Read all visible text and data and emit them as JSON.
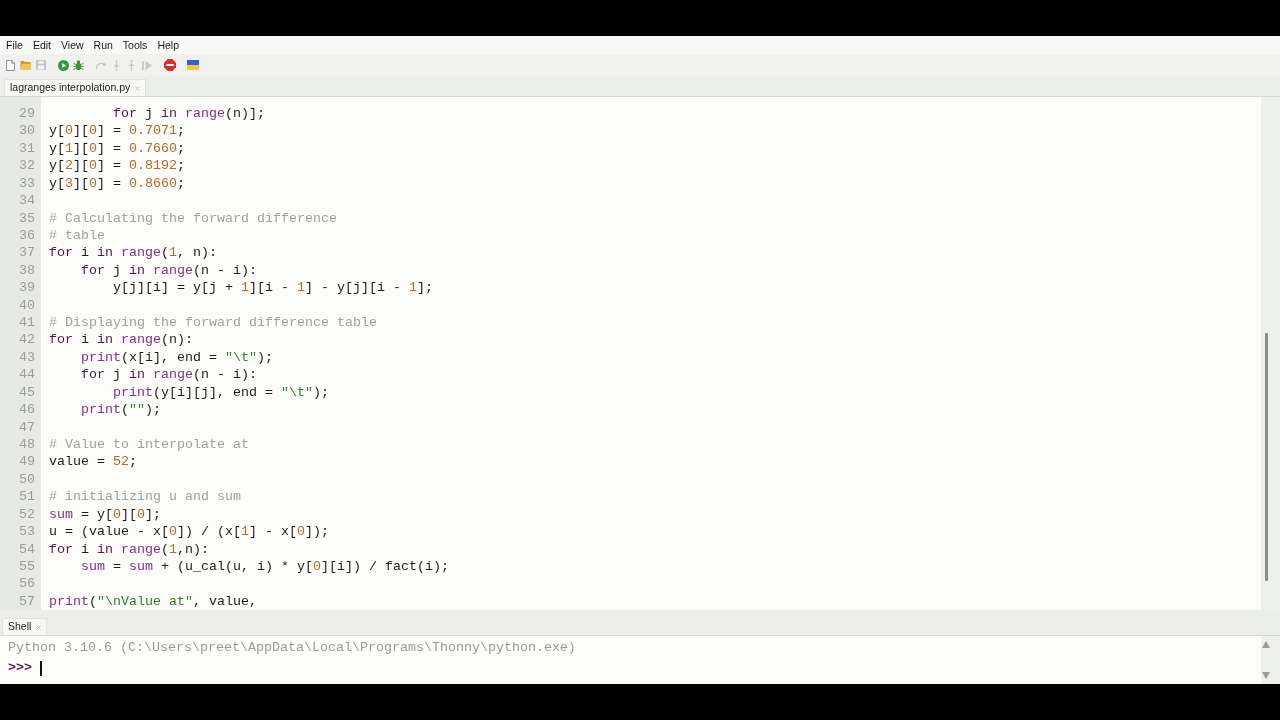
{
  "menu": [
    "File",
    "Edit",
    "View",
    "Run",
    "Tools",
    "Help"
  ],
  "toolbar": [
    [
      {
        "kind": "new_file",
        "disabled": false
      },
      {
        "kind": "open",
        "disabled": false
      },
      {
        "kind": "save",
        "disabled": true
      }
    ],
    [
      {
        "kind": "run",
        "disabled": false
      },
      {
        "kind": "debug",
        "disabled": false
      }
    ],
    [
      {
        "kind": "step_over",
        "disabled": true
      },
      {
        "kind": "step_into",
        "disabled": true
      },
      {
        "kind": "step_out",
        "disabled": true
      },
      {
        "kind": "resume",
        "disabled": true
      }
    ],
    [
      {
        "kind": "stop",
        "disabled": false
      }
    ],
    [
      {
        "kind": "support_ukraine",
        "disabled": false
      }
    ]
  ],
  "editor_tabs": [
    {
      "label": "lagranges interpolation.py",
      "selected": true
    }
  ],
  "editor": {
    "lines": [
      {
        "number": "29",
        "tokens": [
          {
            "kind": "keyword",
            "text": "        for"
          },
          {
            "kind": "plain",
            "text": " j "
          },
          {
            "kind": "keyword",
            "text": "in"
          },
          {
            "kind": "builtin",
            "text": " range"
          },
          {
            "kind": "plain",
            "text": "(n)];"
          }
        ]
      },
      {
        "number": "30",
        "tokens": [
          {
            "kind": "plain",
            "text": "y["
          },
          {
            "kind": "number",
            "text": "0"
          },
          {
            "kind": "plain",
            "text": "]["
          },
          {
            "kind": "number",
            "text": "0"
          },
          {
            "kind": "plain",
            "text": "] = "
          },
          {
            "kind": "number",
            "text": "0.7071"
          },
          {
            "kind": "plain",
            "text": ";"
          }
        ]
      },
      {
        "number": "31",
        "tokens": [
          {
            "kind": "plain",
            "text": "y["
          },
          {
            "kind": "number",
            "text": "1"
          },
          {
            "kind": "plain",
            "text": "]["
          },
          {
            "kind": "number",
            "text": "0"
          },
          {
            "kind": "plain",
            "text": "] = "
          },
          {
            "kind": "number",
            "text": "0.7660"
          },
          {
            "kind": "plain",
            "text": ";"
          }
        ]
      },
      {
        "number": "32",
        "tokens": [
          {
            "kind": "plain",
            "text": "y["
          },
          {
            "kind": "number",
            "text": "2"
          },
          {
            "kind": "plain",
            "text": "]["
          },
          {
            "kind": "number",
            "text": "0"
          },
          {
            "kind": "plain",
            "text": "] = "
          },
          {
            "kind": "number",
            "text": "0.8192"
          },
          {
            "kind": "plain",
            "text": ";"
          }
        ]
      },
      {
        "number": "33",
        "tokens": [
          {
            "kind": "plain",
            "text": "y["
          },
          {
            "kind": "number",
            "text": "3"
          },
          {
            "kind": "plain",
            "text": "]["
          },
          {
            "kind": "number",
            "text": "0"
          },
          {
            "kind": "plain",
            "text": "] = "
          },
          {
            "kind": "number",
            "text": "0.8660"
          },
          {
            "kind": "plain",
            "text": ";"
          }
        ]
      },
      {
        "number": "34"
      },
      {
        "number": "35",
        "tokens": [
          {
            "kind": "comment",
            "text": "# Calculating the forward difference"
          }
        ]
      },
      {
        "number": "36",
        "tokens": [
          {
            "kind": "comment",
            "text": "# table"
          }
        ]
      },
      {
        "number": "37",
        "tokens": [
          {
            "kind": "keyword",
            "text": "for"
          },
          {
            "kind": "plain",
            "text": " i "
          },
          {
            "kind": "keyword",
            "text": "in"
          },
          {
            "kind": "builtin",
            "text": " range"
          },
          {
            "kind": "plain",
            "text": "("
          },
          {
            "kind": "number",
            "text": "1"
          },
          {
            "kind": "plain",
            "text": ", n):"
          }
        ]
      },
      {
        "number": "38",
        "tokens": [
          {
            "kind": "keyword",
            "text": "    for"
          },
          {
            "kind": "plain",
            "text": " j "
          },
          {
            "kind": "keyword",
            "text": "in"
          },
          {
            "kind": "builtin",
            "text": " range"
          },
          {
            "kind": "plain",
            "text": "(n - i):"
          }
        ]
      },
      {
        "number": "39",
        "tokens": [
          {
            "kind": "plain",
            "text": "        y[j][i] = y[j + "
          },
          {
            "kind": "number",
            "text": "1"
          },
          {
            "kind": "plain",
            "text": "][i - "
          },
          {
            "kind": "number",
            "text": "1"
          },
          {
            "kind": "plain",
            "text": "] - y[j][i - "
          },
          {
            "kind": "number",
            "text": "1"
          },
          {
            "kind": "plain",
            "text": "];"
          }
        ]
      },
      {
        "number": "40"
      },
      {
        "number": "41",
        "tokens": [
          {
            "kind": "comment",
            "text": "# Displaying the forward difference table"
          }
        ]
      },
      {
        "number": "42",
        "tokens": [
          {
            "kind": "keyword",
            "text": "for"
          },
          {
            "kind": "plain",
            "text": " i "
          },
          {
            "kind": "keyword",
            "text": "in"
          },
          {
            "kind": "builtin",
            "text": " range"
          },
          {
            "kind": "plain",
            "text": "(n):"
          }
        ]
      },
      {
        "number": "43",
        "tokens": [
          {
            "kind": "builtin",
            "text": "    print"
          },
          {
            "kind": "plain",
            "text": "(x[i], end = "
          },
          {
            "kind": "string",
            "text": "\"\\t\""
          },
          {
            "kind": "plain",
            "text": ");"
          }
        ]
      },
      {
        "number": "44",
        "tokens": [
          {
            "kind": "keyword",
            "text": "    for"
          },
          {
            "kind": "plain",
            "text": " j "
          },
          {
            "kind": "keyword",
            "text": "in"
          },
          {
            "kind": "builtin",
            "text": " range"
          },
          {
            "kind": "plain",
            "text": "(n - i):"
          }
        ]
      },
      {
        "number": "45",
        "tokens": [
          {
            "kind": "builtin",
            "text": "        print"
          },
          {
            "kind": "plain",
            "text": "(y[i][j], end = "
          },
          {
            "kind": "string",
            "text": "\"\\t\""
          },
          {
            "kind": "plain",
            "text": ");"
          }
        ]
      },
      {
        "number": "46",
        "tokens": [
          {
            "kind": "builtin",
            "text": "    print"
          },
          {
            "kind": "plain",
            "text": "("
          },
          {
            "kind": "string",
            "text": "\"\""
          },
          {
            "kind": "plain",
            "text": ");"
          }
        ]
      },
      {
        "number": "47"
      },
      {
        "number": "48",
        "tokens": [
          {
            "kind": "comment",
            "text": "# Value to interpolate at"
          }
        ]
      },
      {
        "number": "49",
        "tokens": [
          {
            "kind": "plain",
            "text": "value = "
          },
          {
            "kind": "number",
            "text": "52"
          },
          {
            "kind": "plain",
            "text": ";"
          }
        ]
      },
      {
        "number": "50"
      },
      {
        "number": "51",
        "tokens": [
          {
            "kind": "comment",
            "text": "# initializing u and sum"
          }
        ]
      },
      {
        "number": "52",
        "tokens": [
          {
            "kind": "builtin",
            "text": "sum"
          },
          {
            "kind": "plain",
            "text": " = y["
          },
          {
            "kind": "number",
            "text": "0"
          },
          {
            "kind": "plain",
            "text": "]["
          },
          {
            "kind": "number",
            "text": "0"
          },
          {
            "kind": "plain",
            "text": "];"
          }
        ]
      },
      {
        "number": "53",
        "tokens": [
          {
            "kind": "plain",
            "text": "u = (value - x["
          },
          {
            "kind": "number",
            "text": "0"
          },
          {
            "kind": "plain",
            "text": "]) / (x["
          },
          {
            "kind": "number",
            "text": "1"
          },
          {
            "kind": "plain",
            "text": "] - x["
          },
          {
            "kind": "number",
            "text": "0"
          },
          {
            "kind": "plain",
            "text": "]);"
          }
        ]
      },
      {
        "number": "54",
        "tokens": [
          {
            "kind": "keyword",
            "text": "for"
          },
          {
            "kind": "plain",
            "text": " i "
          },
          {
            "kind": "keyword",
            "text": "in"
          },
          {
            "kind": "builtin",
            "text": " range"
          },
          {
            "kind": "plain",
            "text": "("
          },
          {
            "kind": "number",
            "text": "1"
          },
          {
            "kind": "plain",
            "text": ",n):"
          }
        ]
      },
      {
        "number": "55",
        "tokens": [
          {
            "kind": "builtin",
            "text": "    sum"
          },
          {
            "kind": "plain",
            "text": " = "
          },
          {
            "kind": "builtin",
            "text": "sum"
          },
          {
            "kind": "plain",
            "text": " + (u_cal(u, i) * y["
          },
          {
            "kind": "number",
            "text": "0"
          },
          {
            "kind": "plain",
            "text": "][i]) / fact(i);"
          }
        ]
      },
      {
        "number": "56"
      },
      {
        "number": "57",
        "tokens": [
          {
            "kind": "builtin",
            "text": "print"
          },
          {
            "kind": "plain",
            "text": "("
          },
          {
            "kind": "string",
            "text": "\"\\nValue at\""
          },
          {
            "kind": "plain",
            "text": ", value,"
          }
        ]
      }
    ]
  },
  "shell": {
    "tab": {
      "label": "Shell",
      "selected": true
    },
    "banner": "Python 3.10.6 (C:\\Users\\preet\\AppData\\Local\\Programs\\Thonny\\python.exe)",
    "prompt": ">>>"
  }
}
